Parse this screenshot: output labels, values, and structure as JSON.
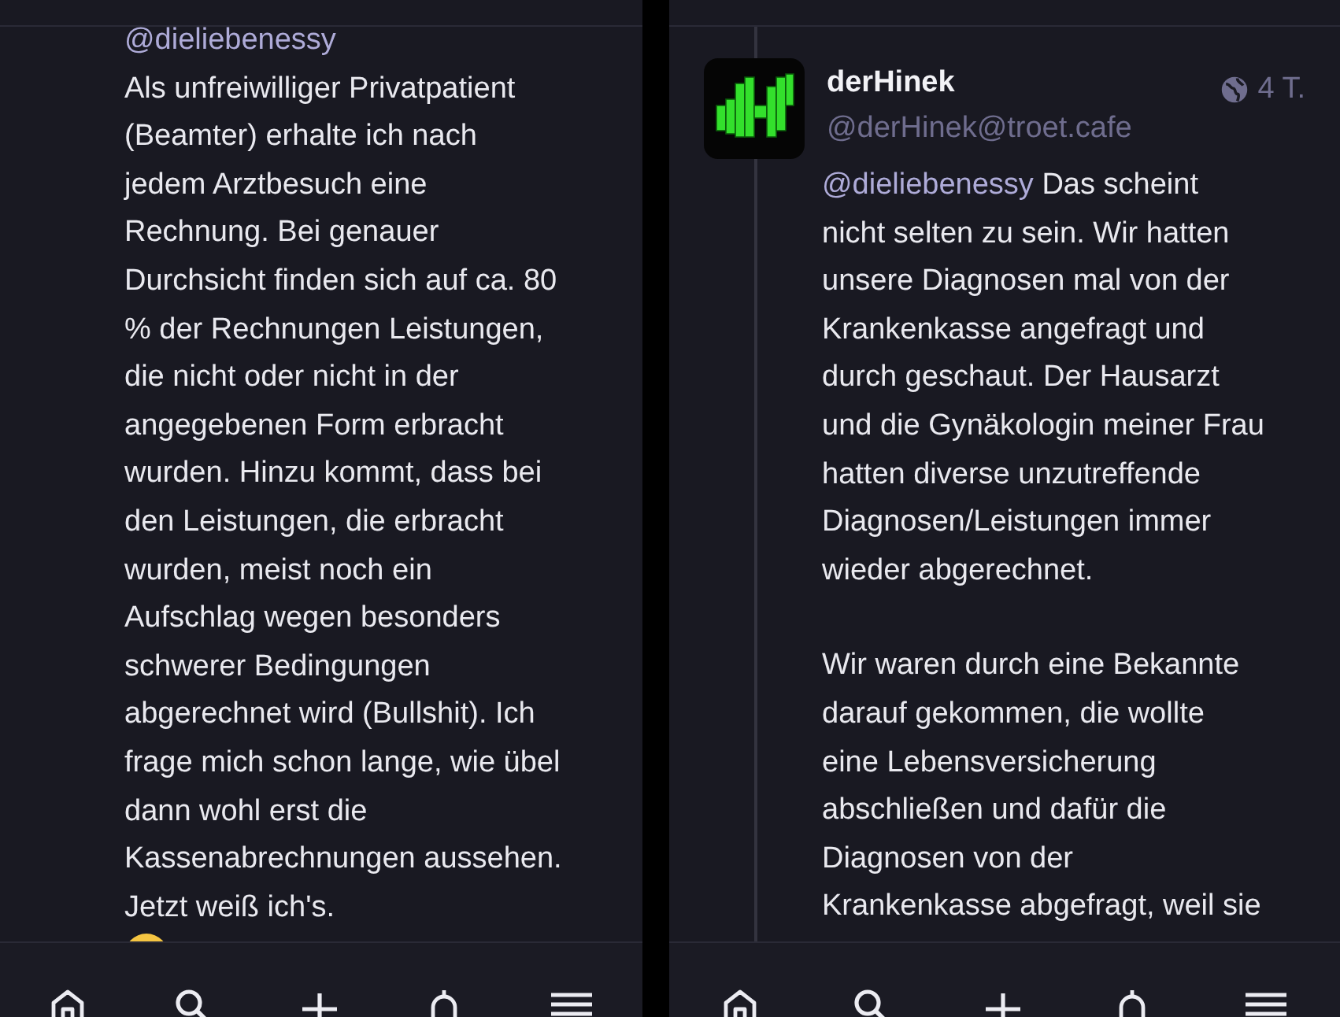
{
  "left_panel": {
    "post": {
      "mention": "@dieliebenessy",
      "lines": [
        "Als unfreiwilliger Privatpatient",
        "(Beamter) erhalte ich nach",
        "jedem Arztbesuch eine",
        "Rechnung. Bei genauer",
        "Durchsicht finden sich auf ca. 80",
        "% der Rechnungen Leistungen,",
        "die nicht oder nicht in der",
        "angegebenen Form erbracht",
        "wurden. Hinzu kommt, dass bei",
        "den Leistungen, die erbracht",
        "wurden, meist noch ein",
        "Aufschlag wegen besonders",
        "schwerer Bedingungen",
        "abgerechnet wird (Bullshit). Ich",
        "frage mich schon lange, wie übel",
        "dann wohl erst die",
        "Kassenabrechnungen aussehen.",
        "Jetzt weiß ich's."
      ]
    },
    "nav": [
      {
        "kind": "home"
      },
      {
        "kind": "search"
      },
      {
        "kind": "compose"
      },
      {
        "kind": "notifications"
      },
      {
        "kind": "menu"
      }
    ]
  },
  "right_panel": {
    "post": {
      "author": {
        "name": "derHinek",
        "handle": "@derHinek@troet.cafe"
      },
      "public": true,
      "time": "4 T.",
      "mention": "@dieliebenessy",
      "paragraphs": [
        {
          "lines": [
            "Das scheint",
            "nicht selten zu sein. Wir hatten",
            "unsere Diagnosen mal von der",
            "Krankenkasse angefragt und",
            "durch geschaut. Der Hausarzt",
            "und die Gynäkologin meiner Frau",
            "hatten diverse unzutreffende",
            "Diagnosen/Leistungen immer",
            "wieder abgerechnet."
          ]
        },
        {
          "lines": [
            "Wir waren durch eine Bekannte",
            "darauf gekommen, die wollte",
            "eine Lebensversicherung",
            "abschließen und dafür die",
            "Diagnosen von der",
            "Krankenkasse abgefragt, weil sie"
          ]
        }
      ]
    },
    "nav": [
      {
        "kind": "home"
      },
      {
        "kind": "search"
      },
      {
        "kind": "compose"
      },
      {
        "kind": "notifications"
      },
      {
        "kind": "menu"
      }
    ]
  }
}
